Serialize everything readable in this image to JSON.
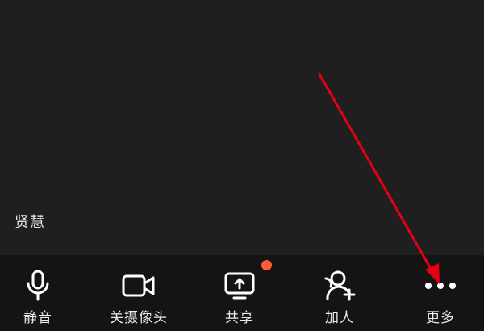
{
  "participant": {
    "name": "贤慧"
  },
  "toolbar": {
    "items": [
      {
        "label": "静音",
        "icon": "microphone-icon"
      },
      {
        "label": "关摄像头",
        "icon": "video-camera-icon"
      },
      {
        "label": "共享",
        "icon": "screen-share-icon",
        "badge": true
      },
      {
        "label": "加人",
        "icon": "add-person-icon"
      },
      {
        "label": "更多",
        "icon": "more-dots-icon"
      }
    ]
  },
  "colors": {
    "background": "#1f1f1f",
    "toolbar_background": "#141414",
    "badge": "#ff5a3a",
    "annotation_arrow": "#e60012"
  }
}
